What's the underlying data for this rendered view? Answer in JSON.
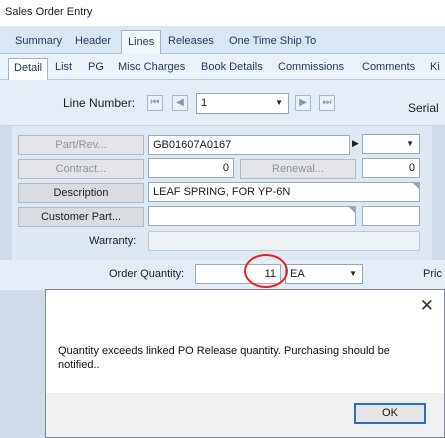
{
  "window": {
    "title": "Sales Order Entry"
  },
  "main_tabs": [
    "Summary",
    "Header",
    "Lines",
    "Releases",
    "One Time Ship To"
  ],
  "sub_tabs": [
    "Detail",
    "List",
    "PG",
    "Misc Charges",
    "Book Details",
    "Commissions",
    "Comments",
    "Ki"
  ],
  "line_nav": {
    "label": "Line Number:",
    "value": "1",
    "serial_label": "Serial"
  },
  "form": {
    "part_rev_label": "Part/Rev...",
    "part_rev_value": "GB01607A0167",
    "contract_label": "Contract...",
    "contract_value": "0",
    "renewal_label": "Renewal...",
    "renewal_value": "0",
    "description_label": "Description",
    "description_value": "LEAF SPRING, FOR YP-6N",
    "customer_part_label": "Customer Part...",
    "customer_part_value": "",
    "warranty_label": "Warranty:",
    "warranty_value": ""
  },
  "order": {
    "quantity_label": "Order Quantity:",
    "quantity_value": "11",
    "uom_value": "EA",
    "price_label": "Pric"
  },
  "dialog": {
    "message": "Quantity exceeds linked PO Release quantity. Purchasing  should be notified..",
    "ok_label": "OK",
    "close_glyph": "✕"
  },
  "icons": {
    "nav_first": "⏮",
    "nav_prev": "◀",
    "nav_next": "▶",
    "nav_last": "⏭",
    "dropdown": "▼",
    "part_arrow": "▶"
  },
  "colors": {
    "highlight_circle": "#e52222",
    "ok_focus": "#2c6fc0"
  }
}
